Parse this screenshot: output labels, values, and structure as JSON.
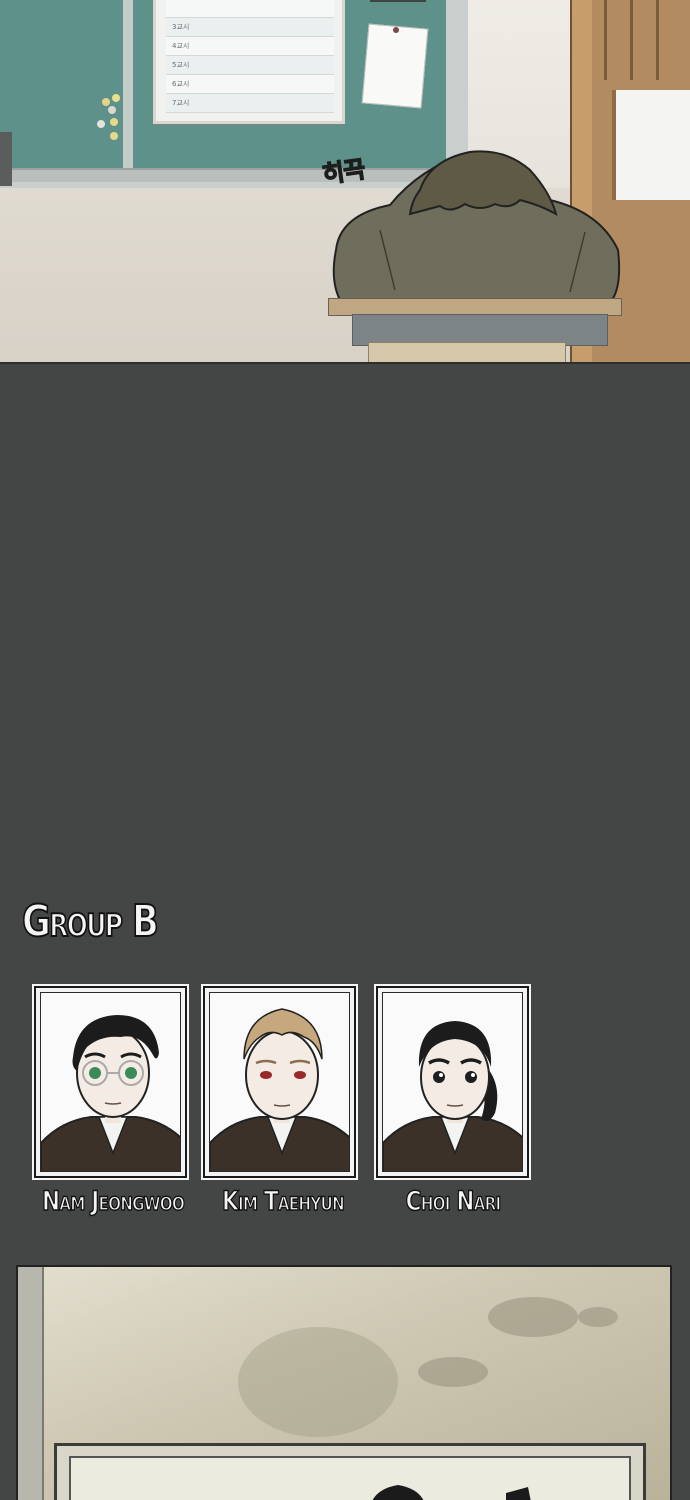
{
  "top_panel": {
    "sfx_text": "히끅",
    "timetable_rows": [
      "",
      "3교시",
      "4교시",
      "5교시",
      "6교시",
      "7교시"
    ]
  },
  "group": {
    "title": "Group B",
    "members": [
      {
        "name": "Nam Jeongwoo",
        "eye_color": "#3c8a5a",
        "hair_color": "#1c1c1c",
        "glasses": true,
        "long_hair": false
      },
      {
        "name": "Kim Taehyun",
        "eye_color": "#9a2a2a",
        "hair_color": "#c7a77e",
        "glasses": false,
        "long_hair": false
      },
      {
        "name": "Choi Nari",
        "eye_color": "#1e1e1e",
        "hair_color": "#1c1c1c",
        "glasses": false,
        "long_hair": true
      }
    ]
  },
  "colors": {
    "background": "#444646",
    "chalkboard": "#5d9189",
    "uniform": "#3b3128",
    "skin": "#f4ece4"
  }
}
